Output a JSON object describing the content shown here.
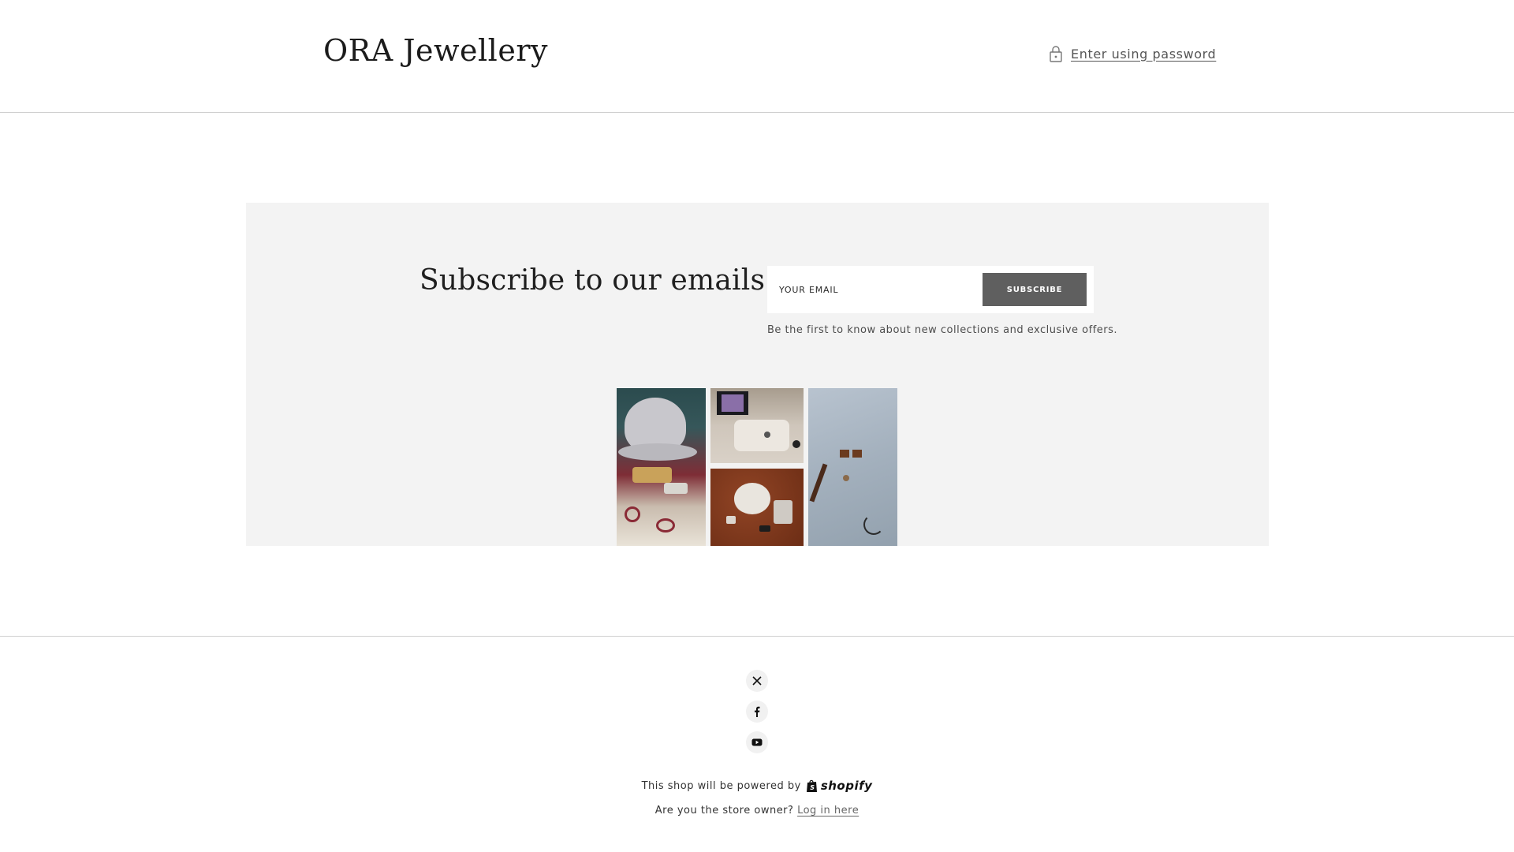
{
  "header": {
    "brand": "ORA Jewellery",
    "password_link": "Enter using password",
    "lock_icon": "lock-icon"
  },
  "newsletter": {
    "title": "Subscribe to our emails",
    "email_placeholder": "YOUR EMAIL",
    "subscribe_label": "SUBSCRIBE",
    "note": "Be the first to know about new collections and exclusive offers."
  },
  "footer": {
    "social": [
      {
        "icon": "x-twitter-icon"
      },
      {
        "icon": "facebook-icon"
      },
      {
        "icon": "youtube-icon"
      }
    ],
    "powered_text": "This shop will be powered by",
    "shopify_wordmark": "shopify",
    "owner_text": "Are you the store owner?",
    "login_link": "Log in here"
  },
  "colors": {
    "background": "#ffffff",
    "panel": "#f3f3f3",
    "button": "#5f5f5f",
    "divider": "#cfcfcf"
  }
}
